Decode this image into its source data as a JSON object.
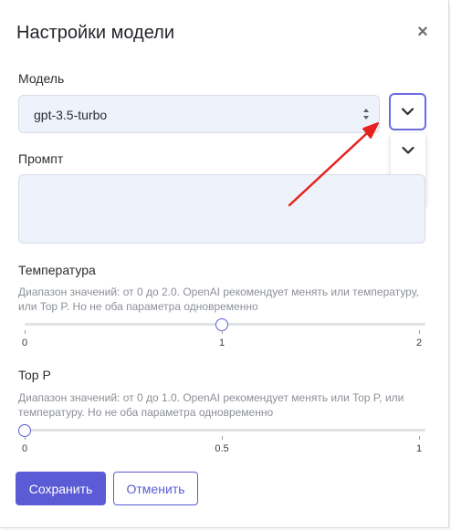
{
  "dialog": {
    "title": "Настройки модели",
    "close_symbol": "×"
  },
  "model": {
    "label": "Модель",
    "value": "gpt-3.5-turbo",
    "menu_items": [
      "chevron-down-icon",
      "edit-icon"
    ]
  },
  "prompt": {
    "label": "Промпт",
    "value": ""
  },
  "temperature": {
    "label": "Температура",
    "hint": "Диапазон значений: от 0 до 2.0. OpenAI рекомендует менять или температуру, или Top P. Но не оба параметра одновременно",
    "min": 0,
    "max": 2,
    "value": 1,
    "ticks": [
      "0",
      "1",
      "2"
    ]
  },
  "top_p": {
    "label": "Top P",
    "hint": "Диапазон значений: от 0 до 1.0. OpenAI рекомендует менять или Top P, или температуру. Но не оба параметра одновременно",
    "min": 0,
    "max": 1,
    "value": 0,
    "ticks": [
      "0",
      "0.5",
      "1"
    ]
  },
  "actions": {
    "save": "Сохранить",
    "cancel": "Отменить"
  },
  "colors": {
    "accent": "#5b5bd6",
    "annotation_arrow": "#e3231f"
  }
}
